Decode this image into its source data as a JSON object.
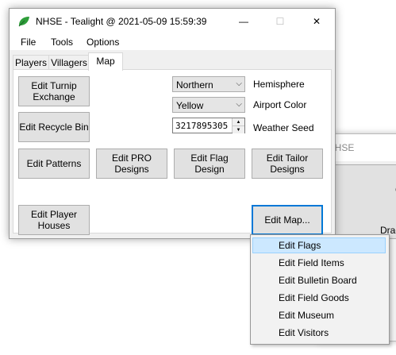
{
  "background_window": {
    "title": "NHSE",
    "edge_text_1": "C",
    "edge_text_2": "Drag"
  },
  "window": {
    "title": "NHSE - Tealight @ 2021-05-09 15:59:39",
    "icon": "leaf-icon",
    "controls": {
      "minimize": "—",
      "maximize": "☐",
      "close": "✕"
    }
  },
  "menu": {
    "file": "File",
    "tools": "Tools",
    "options": "Options"
  },
  "tabs": [
    {
      "label": "Players"
    },
    {
      "label": "Villagers"
    },
    {
      "label": "Map"
    }
  ],
  "map_tab": {
    "edit_turnip_exchange": "Edit Turnip Exchange",
    "edit_recycle_bin": "Edit Recycle Bin",
    "edit_patterns": "Edit Patterns",
    "edit_pro_designs": "Edit PRO Designs",
    "edit_flag_design": "Edit Flag Design",
    "edit_tailor_designs": "Edit Tailor Designs",
    "edit_player_houses": "Edit Player Houses",
    "edit_map": "Edit Map...",
    "hemisphere_value": "Northern",
    "hemisphere_label": "Hemisphere",
    "airport_color_value": "Yellow",
    "airport_color_label": "Airport Color",
    "weather_seed_value": "3217895305",
    "weather_seed_label": "Weather Seed"
  },
  "context_menu": {
    "items": [
      {
        "label": "Edit Flags",
        "highlighted": true
      },
      {
        "label": "Edit Field Items"
      },
      {
        "label": "Edit Bulletin Board"
      },
      {
        "label": "Edit Field Goods"
      },
      {
        "label": "Edit Museum"
      },
      {
        "label": "Edit Visitors"
      }
    ]
  },
  "colors": {
    "accent": "#0078d7",
    "menu_highlight": "#cce8ff",
    "leaf_green": "#2e9e3a"
  }
}
